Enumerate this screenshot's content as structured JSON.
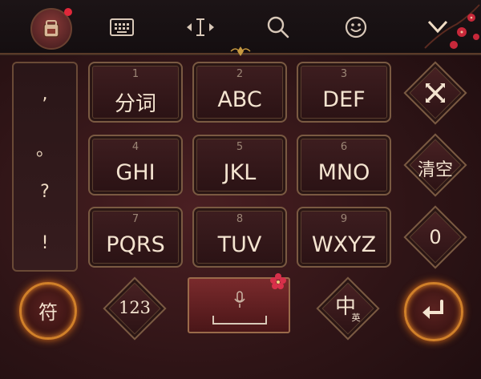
{
  "toolbar": {
    "icons": [
      "skin-backpack-icon",
      "keyboard-icon",
      "cursor-edit-icon",
      "search-icon",
      "emoji-icon",
      "collapse-keyboard-icon"
    ],
    "notification_color": "#e0283a"
  },
  "punctuation": [
    ",",
    "。",
    "?",
    "!"
  ],
  "keys": [
    {
      "num": "1",
      "label": "分词"
    },
    {
      "num": "2",
      "label": "ABC"
    },
    {
      "num": "3",
      "label": "DEF"
    },
    {
      "num": "4",
      "label": "GHI"
    },
    {
      "num": "5",
      "label": "JKL"
    },
    {
      "num": "6",
      "label": "MNO"
    },
    {
      "num": "7",
      "label": "PQRS"
    },
    {
      "num": "8",
      "label": "TUV"
    },
    {
      "num": "9",
      "label": "WXYZ"
    }
  ],
  "side": {
    "delete_icon": "delete-icon",
    "clear_label": "清空",
    "zero_label": "0"
  },
  "bottom": {
    "symbol_label": "符",
    "numeric_label": "123",
    "mic_icon": "microphone-icon",
    "lang_main": "中",
    "lang_sub": "英",
    "enter_icon": "enter-icon"
  },
  "colors": {
    "accent_gold": "#d0802a",
    "key_border": "#7a5a42",
    "key_text": "#f4e4d0"
  }
}
